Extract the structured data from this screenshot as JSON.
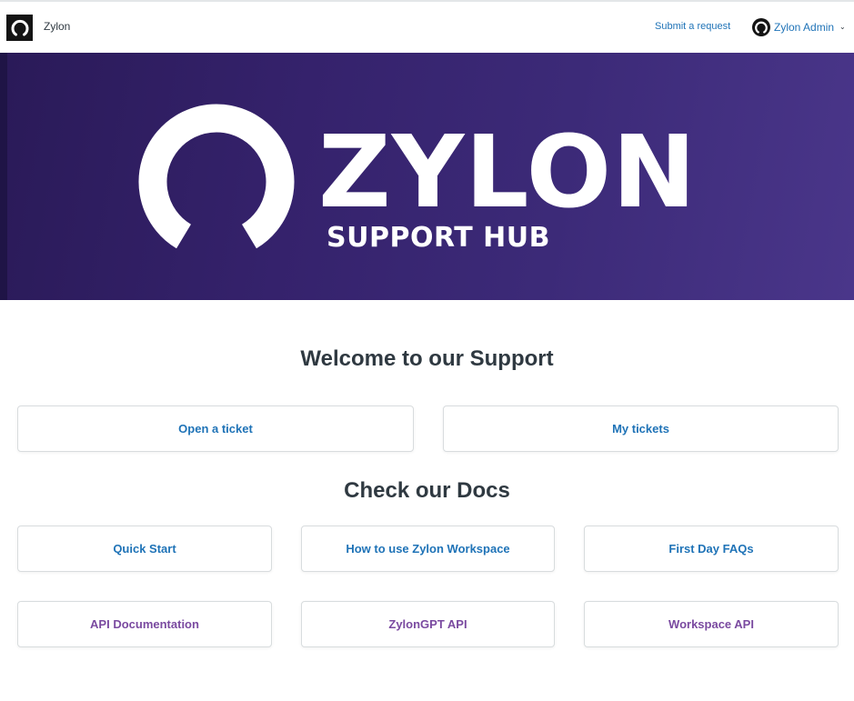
{
  "header": {
    "brand_name": "Zylon",
    "submit_request": "Submit a request",
    "user_name": "Zylon Admin",
    "logo_icon": "zylon-ring-icon",
    "chevron_icon": "chevron-down-icon"
  },
  "hero": {
    "title": "ZYLON",
    "subtitle": "SUPPORT HUB",
    "background_color": "#35226c"
  },
  "support": {
    "title": "Welcome to our Support",
    "buttons": [
      "Open a ticket",
      "My tickets"
    ]
  },
  "docs": {
    "title": "Check our Docs",
    "row1": [
      "Quick Start",
      "How to use Zylon Workspace",
      "First Day FAQs"
    ],
    "row2": [
      "API Documentation",
      "ZylonGPT API",
      "Workspace API"
    ]
  },
  "colors": {
    "link_blue": "#1f73b7",
    "api_purple": "#7a4aa0",
    "text_dark": "#2f3941"
  }
}
